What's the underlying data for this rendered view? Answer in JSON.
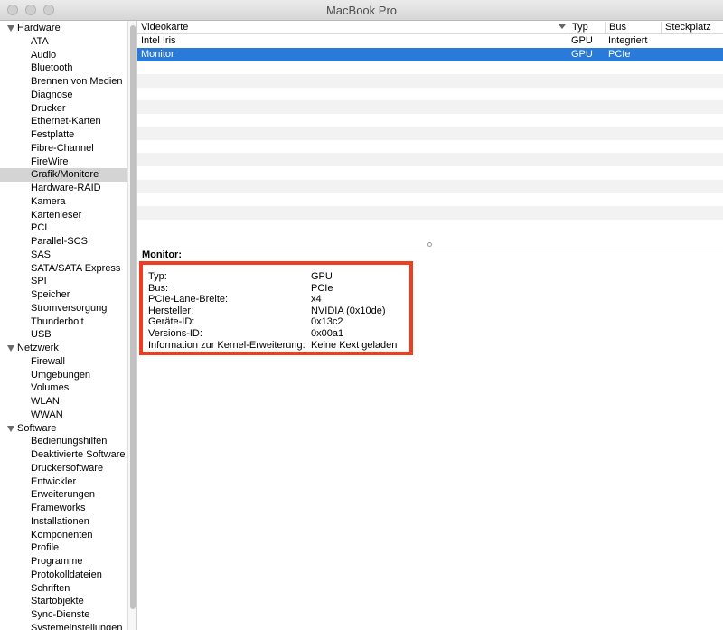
{
  "window": {
    "title": "MacBook Pro"
  },
  "sidebar": {
    "groups": [
      {
        "label": "Hardware",
        "items": [
          "ATA",
          "Audio",
          "Bluetooth",
          "Brennen von Medien",
          "Diagnose",
          "Drucker",
          "Ethernet-Karten",
          "Festplatte",
          "Fibre-Channel",
          "FireWire",
          "Grafik/Monitore",
          "Hardware-RAID",
          "Kamera",
          "Kartenleser",
          "PCI",
          "Parallel-SCSI",
          "SAS",
          "SATA/SATA Express",
          "SPI",
          "Speicher",
          "Stromversorgung",
          "Thunderbolt",
          "USB"
        ]
      },
      {
        "label": "Netzwerk",
        "items": [
          "Firewall",
          "Umgebungen",
          "Volumes",
          "WLAN",
          "WWAN"
        ]
      },
      {
        "label": "Software",
        "items": [
          "Bedienungshilfen",
          "Deaktivierte Software",
          "Druckersoftware",
          "Entwickler",
          "Erweiterungen",
          "Frameworks",
          "Installationen",
          "Komponenten",
          "Profile",
          "Programme",
          "Protokolldateien",
          "Schriften",
          "Startobjekte",
          "Sync-Dienste",
          "Systemeinstellungen"
        ]
      }
    ],
    "selected": "Grafik/Monitore"
  },
  "table": {
    "columns": [
      "Videokarte",
      "Typ",
      "Bus",
      "Steckplatz"
    ],
    "rows": [
      [
        "Intel Iris",
        "GPU",
        "Integriert",
        ""
      ],
      [
        "Monitor",
        "GPU",
        "PCIe",
        ""
      ]
    ],
    "selected_row": 1
  },
  "detail": {
    "title": "Monitor:",
    "fields": [
      {
        "key": "Typ:",
        "value": "GPU"
      },
      {
        "key": "Bus:",
        "value": "PCIe"
      },
      {
        "key": "PCIe-Lane-Breite:",
        "value": "x4"
      },
      {
        "key": "Hersteller:",
        "value": "NVIDIA (0x10de)"
      },
      {
        "key": "Geräte-ID:",
        "value": "0x13c2"
      },
      {
        "key": "Versions-ID:",
        "value": "0x00a1"
      },
      {
        "key": "Information zur Kernel-Erweiterung:",
        "value": "Keine Kext geladen"
      }
    ]
  },
  "colors": {
    "selection": "#2a7ad9",
    "highlight_border": "#f03c1f",
    "sidebar_selection": "#d4d4d4"
  }
}
